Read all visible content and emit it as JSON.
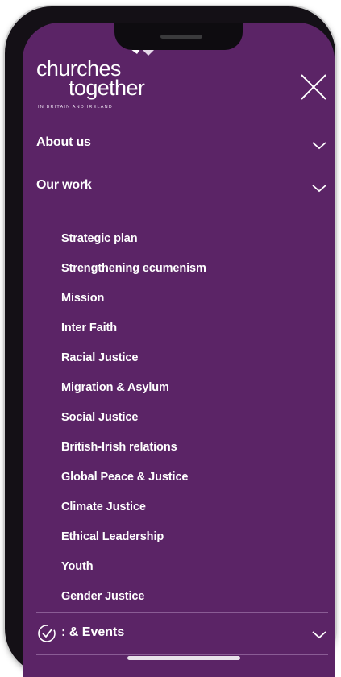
{
  "header": {
    "logo_line1": "churches",
    "logo_line2": "together",
    "logo_tagline": "IN BRITAIN AND IRELAND",
    "close_icon": "close-x-icon"
  },
  "menu": {
    "about": {
      "label": "About us",
      "icon": "chevron-down-icon"
    },
    "work": {
      "label": "Our work",
      "icon": "chevron-down-icon",
      "items": [
        "Strategic plan",
        "Strengthening ecumenism",
        "Mission",
        "Inter Faith",
        "Racial Justice",
        "Migration & Asylum",
        "Social Justice",
        "British-Irish relations",
        "Global Peace & Justice",
        "Climate Justice",
        "Ethical Leadership",
        "Youth",
        "Gender Justice"
      ]
    },
    "events": {
      "label": ": & Events",
      "icon": "hand-pointer-icon"
    }
  },
  "colors": {
    "background": "#5b2466",
    "text": "#ffffff",
    "divider": "#8a5c95",
    "frame": "#141016"
  }
}
